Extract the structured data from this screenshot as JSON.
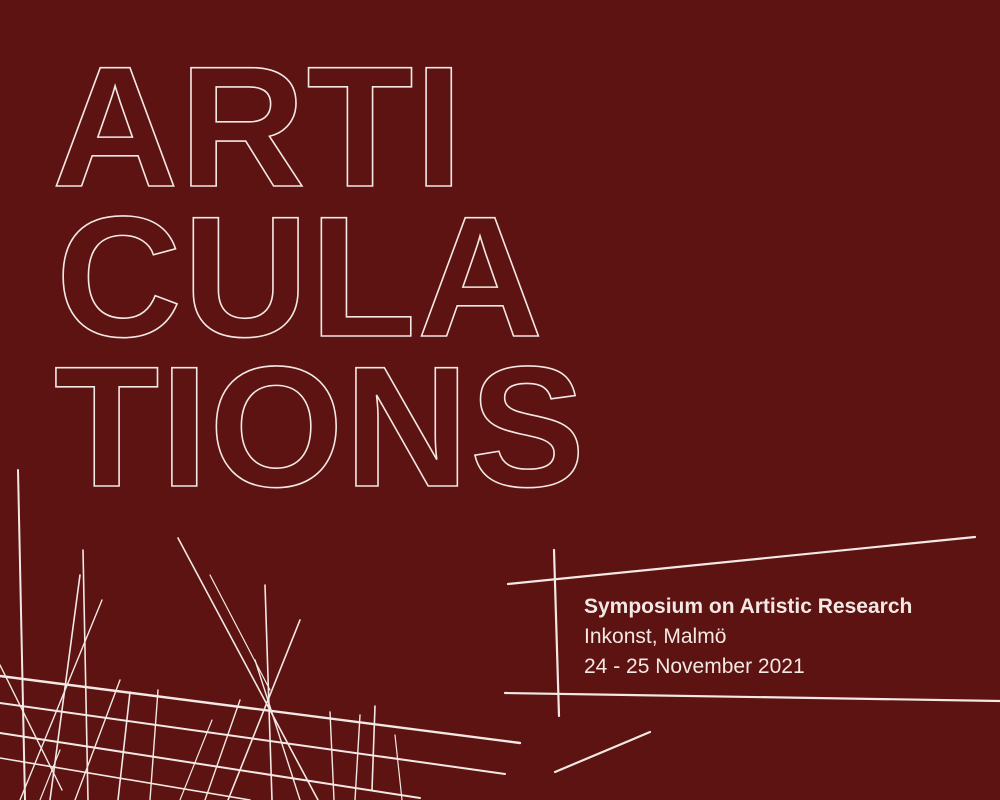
{
  "poster": {
    "background": "#5c1311",
    "line_color": "#f3e8e4",
    "title_lines": [
      "ARTI",
      "CULA",
      "TIONS"
    ],
    "event": "Symposium on Artistic Research",
    "venue": "Inkonst, Malmö",
    "dates": "24 - 25 November 2021"
  }
}
